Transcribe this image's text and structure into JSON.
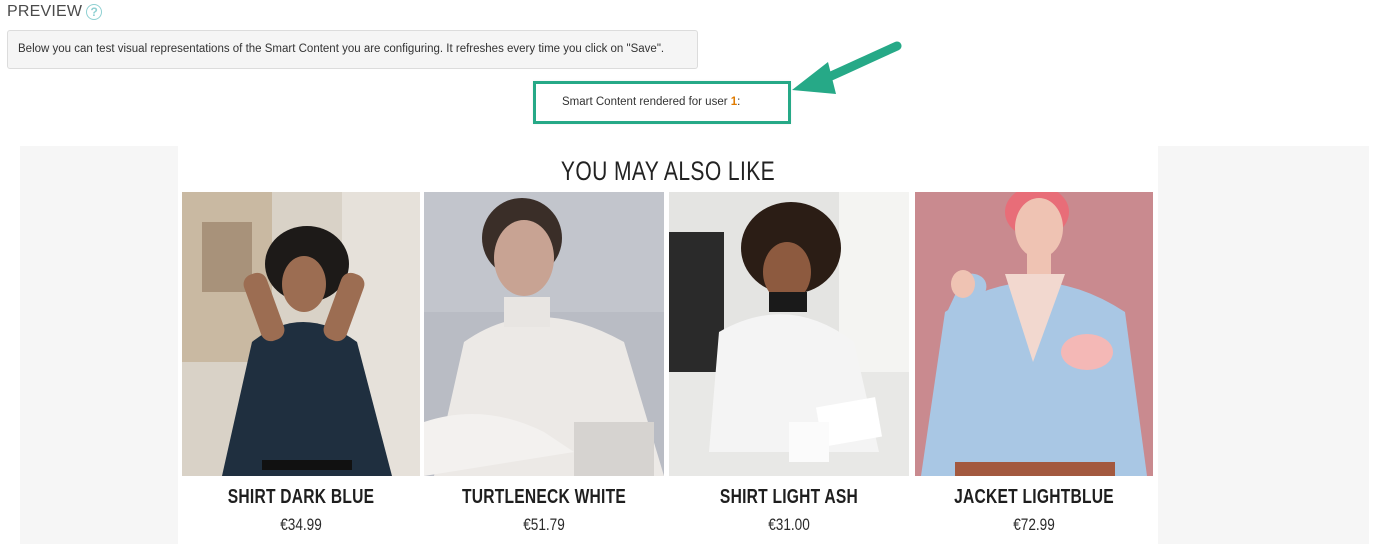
{
  "header": {
    "title": "PREVIEW",
    "help_icon": "question-circle-icon",
    "help_glyph": "?"
  },
  "info": {
    "text": "Below you can test visual representations of the Smart Content you are configuring. It refreshes every time you click on \"Save\"."
  },
  "render": {
    "label": "Smart Content rendered for user ",
    "user_id": "1",
    "suffix": ":"
  },
  "colors": {
    "highlight": "#26a987",
    "user_id": "#e07b00",
    "help_icon": "#8fd0d2"
  },
  "widget": {
    "title": "YOU MAY ALSO LIKE",
    "products": [
      {
        "name": "SHIRT DARK BLUE",
        "price": "€34.99",
        "image": "woman-dark-blue-shirt-photo"
      },
      {
        "name": "TURTLENECK WHITE",
        "price": "€51.79",
        "image": "woman-white-turtleneck-photo"
      },
      {
        "name": "SHIRT LIGHT ASH",
        "price": "€31.00",
        "image": "woman-light-ash-shirt-office-photo"
      },
      {
        "name": "JACKET LIGHTBLUE",
        "price": "€72.99",
        "image": "woman-lightblue-jacket-pink-hair-photo"
      }
    ]
  }
}
